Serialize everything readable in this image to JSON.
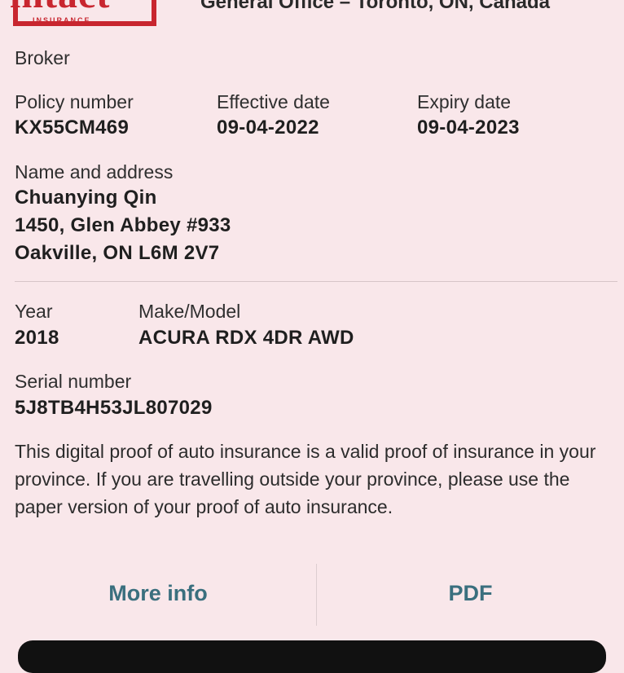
{
  "header": {
    "logo_text": "intact",
    "logo_subtext": "INSURANCE",
    "office_text": "General Office – Toronto, ON, Canada"
  },
  "broker": {
    "label": "Broker"
  },
  "policy": {
    "number_label": "Policy number",
    "number_value": "KX55CM469",
    "effective_label": "Effective date",
    "effective_value": "09-04-2022",
    "expiry_label": "Expiry date",
    "expiry_value": "09-04-2023"
  },
  "insured": {
    "label": "Name and address",
    "name": "Chuanying Qin",
    "address_line1": "1450, Glen Abbey #933",
    "address_line2": "Oakville, ON L6M 2V7"
  },
  "vehicle": {
    "year_label": "Year",
    "year_value": "2018",
    "make_label": "Make/Model",
    "make_value": "ACURA RDX 4DR AWD",
    "serial_label": "Serial number",
    "serial_value": "5J8TB4H53JL807029"
  },
  "disclaimer": "This digital proof of auto insurance is a valid proof of insurance in your province. If you are travelling outside your province, please use the paper version of your proof of auto insurance.",
  "actions": {
    "more_info_label": "More info",
    "pdf_label": "PDF"
  },
  "colors": {
    "background": "#f9e7ea",
    "brand_red": "#c8262f",
    "action_teal": "#3a6f7e"
  }
}
